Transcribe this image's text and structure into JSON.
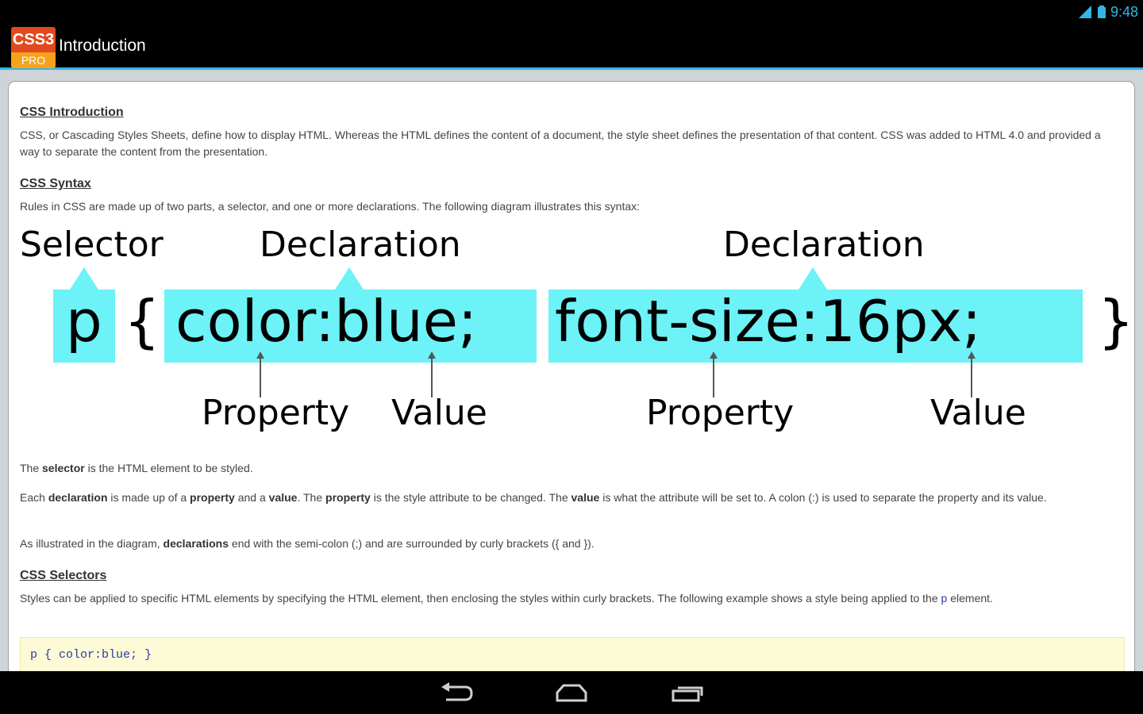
{
  "status_bar": {
    "time": "9:48"
  },
  "app": {
    "logo_top": "CSS3",
    "logo_bottom": "PRO",
    "title": "Introduction"
  },
  "sections": {
    "intro": {
      "heading": "CSS Introduction",
      "text": "CSS, or Cascading Styles Sheets, define how to display HTML. Whereas the HTML defines the content of a document, the style sheet defines the presentation of that content. CSS was added to HTML 4.0 and provided a way to separate the content from the presentation."
    },
    "syntax": {
      "heading": "CSS Syntax",
      "text": "Rules in CSS are made up of two parts, a selector, and one or more declarations. The following diagram illustrates this syntax:"
    },
    "selectors": {
      "heading": "CSS Selectors",
      "text_before": "Styles can be applied to specific HTML elements by specifying the HTML element, then enclosing the styles within curly brackets. The following example shows a style being applied to the ",
      "text_code": "p",
      "text_after": " element."
    }
  },
  "diagram": {
    "selector_label": "Selector",
    "declaration_label_1": "Declaration",
    "declaration_label_2": "Declaration",
    "selector_code": "p",
    "open_brace": "{",
    "declaration_code_1": "color:blue;",
    "declaration_code_2": "font-size:16px;",
    "close_brace": "}",
    "property_label_1": "Property",
    "value_label_1": "Value",
    "property_label_2": "Property",
    "value_label_2": "Value",
    "highlight_color": "#6cf2f7"
  },
  "explanations": {
    "p1": {
      "a": "The ",
      "b1": "selector",
      "c": " is the HTML element to be styled."
    },
    "p2": {
      "a": "Each ",
      "b1": "declaration",
      "c": " is made up of a ",
      "b2": "property",
      "d": " and a ",
      "b3": "value",
      "e": ". The ",
      "b4": "property",
      "f": " is the style attribute to be changed. The ",
      "b5": "value",
      "g": " is what the attribute will be set to. A colon (:) is used to separate the property and its value."
    },
    "p3": {
      "a": "As illustrated in the diagram, ",
      "b1": "declarations",
      "c": " end with the semi-colon (;) and are surrounded by curly brackets ({ and })."
    }
  },
  "code_example": "p { color:blue; }",
  "nav_icons": [
    "back-icon",
    "home-icon",
    "recent-apps-icon"
  ],
  "colors": {
    "accent": "#33b5e5",
    "logo_red": "#e14a1f",
    "logo_orange": "#f7a21b",
    "code_bg": "#fdfbd7"
  }
}
